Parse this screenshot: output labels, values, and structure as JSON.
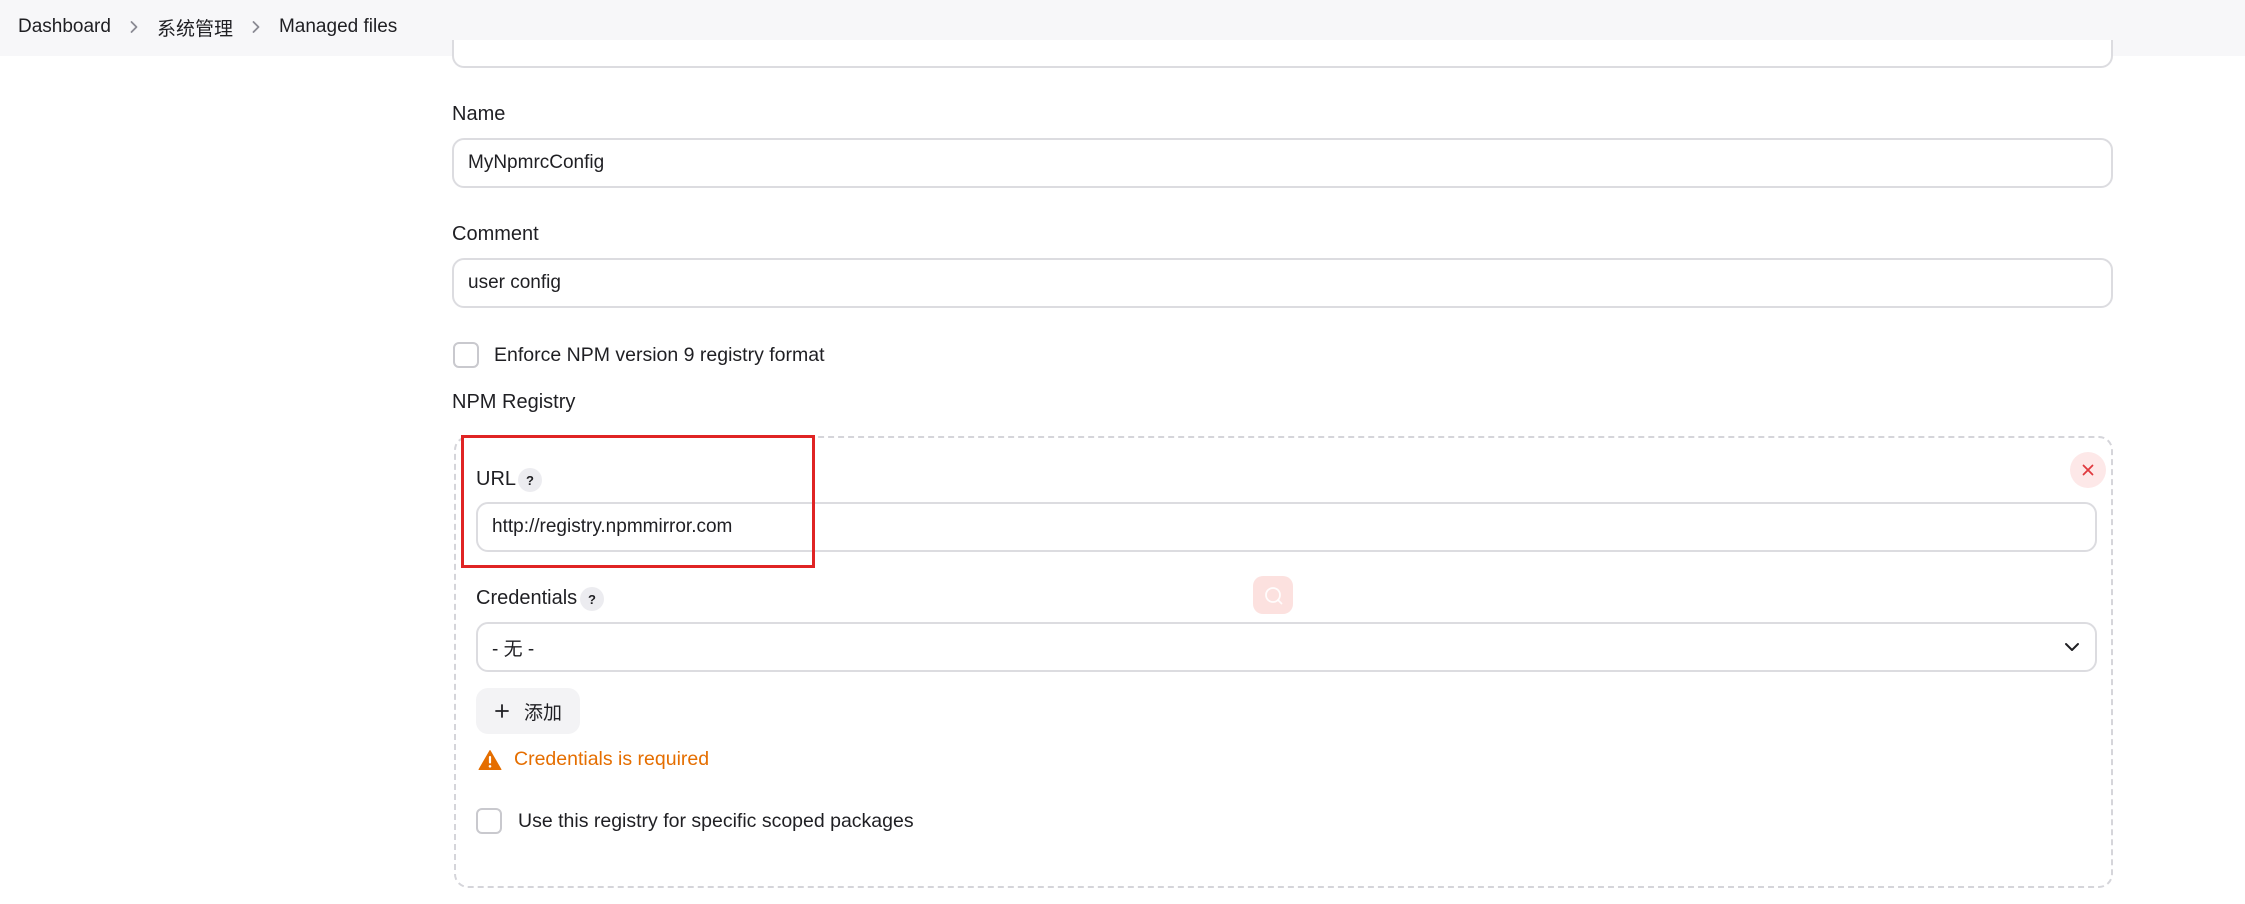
{
  "breadcrumb": {
    "items": [
      "Dashboard",
      "系统管理",
      "Managed files"
    ]
  },
  "form": {
    "name_label": "Name",
    "name_value": "MyNpmrcConfig",
    "comment_label": "Comment",
    "comment_value": "user config",
    "enforce_label": "Enforce NPM version 9 registry format",
    "enforce_checked": false,
    "registry_section_label": "NPM Registry"
  },
  "registry": {
    "url_label": "URL",
    "url_help": "?",
    "url_value": "http://registry.npmmirror.com",
    "credentials_label": "Credentials",
    "credentials_help": "?",
    "credentials_value": "- 无 -",
    "add_button_label": "添加",
    "warning_text": "Credentials is required",
    "scoped_label": "Use this registry for specific scoped packages",
    "scoped_checked": false
  },
  "icons": {
    "breadcrumb_separator": "chevron-right-icon",
    "delete": "close-icon",
    "select": "chevron-down-icon",
    "add": "plus-icon",
    "warning": "warning-icon",
    "floating": "search-icon"
  },
  "colors": {
    "warning": "#e56e00",
    "delete": "#e0393e",
    "highlight": "#e02424",
    "border": "#dcdce0"
  }
}
